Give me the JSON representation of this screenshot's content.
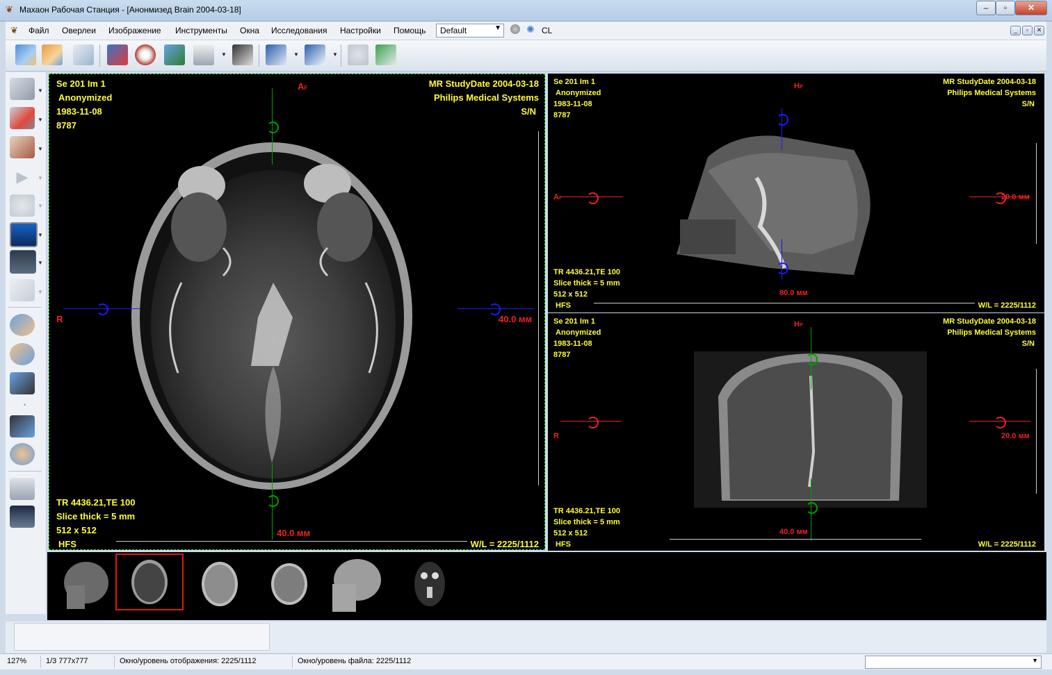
{
  "window": {
    "title": "Махаон Рабочая Станция - [Анонмизед Brain 2004-03-18]"
  },
  "menu": {
    "items": [
      "Файл",
      "Оверлеи",
      "Изображение",
      "Инструменты",
      "Окна",
      "Исследования",
      "Настройки",
      "Помощь"
    ],
    "preset_value": "Default",
    "cl_label": "CL"
  },
  "viewports": {
    "axial": {
      "top_left": [
        "Se 201 Im 1",
        "Anonymized",
        "1983-11-08",
        "8787"
      ],
      "top_right": [
        "MR StudyDate 2004-03-18",
        "Philips Medical Systems",
        "S/N"
      ],
      "bottom_left": [
        "TR 4436.21,TE 100",
        "Slice thick = 5 mm",
        "512 x 512",
        "HFS"
      ],
      "wl": "W/L = 2225/1112",
      "orient_top": "A",
      "orient_top_sub": "F",
      "orient_left": "R",
      "measure_right": "40.0 мм",
      "measure_bottom": "40.0 мм"
    },
    "sagittal": {
      "top_left": [
        "Se 201 Im 1",
        "Anonymized",
        "1983-11-08",
        "8787"
      ],
      "top_right": [
        "MR StudyDate 2004-03-18",
        "Philips Medical Systems",
        "S/N"
      ],
      "bottom_left": [
        "TR 4436.21,TE 100",
        "Slice thick = 5 mm",
        "512 x 512",
        "HFS"
      ],
      "wl": "W/L = 2225/1112",
      "orient_top": "H",
      "orient_top_sub": "P",
      "orient_left": "A",
      "orient_left_sub": "F",
      "measure_right": "20.0 мм",
      "measure_bottom": "80.0 мм"
    },
    "coronal": {
      "top_left": [
        "Se 201 Im 1",
        "Anonymized",
        "1983-11-08",
        "8787"
      ],
      "top_right": [
        "MR StudyDate 2004-03-18",
        "Philips Medical Systems",
        "S/N"
      ],
      "bottom_left": [
        "TR 4436.21,TE 100",
        "Slice thick = 5 mm",
        "512 x 512",
        "HFS"
      ],
      "wl": "W/L = 2225/1112",
      "orient_top": "H",
      "orient_top_sub": "P",
      "orient_left": "R",
      "measure_right": "20.0 мм",
      "measure_bottom": "40.0 мм"
    }
  },
  "status": {
    "zoom": "127%",
    "image_info": "1/3 777x777",
    "display_wl": "Окно/уровень отображения: 2225/1112",
    "file_wl": "Окно/уровень файла: 2225/1112"
  },
  "colors": {
    "overlay_text": "#ffff33",
    "orientation_text": "#ee2222",
    "crosshair_blue": "#1a1aff",
    "crosshair_green": "#00a000",
    "crosshair_red": "#ee2222",
    "selection_border": "#e01818"
  }
}
